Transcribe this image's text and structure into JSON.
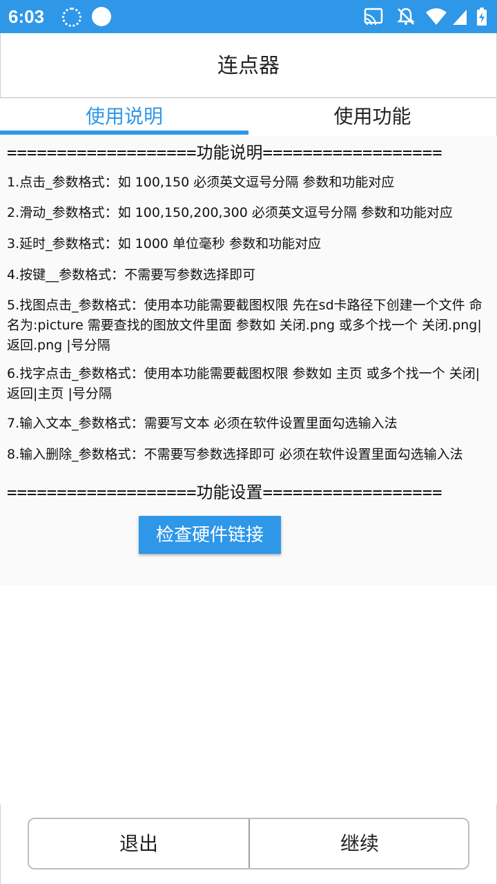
{
  "status_bar": {
    "time": "6:03",
    "icons": [
      "notification-dotted-circle-icon",
      "notification-circle-icon",
      "cast-icon",
      "notifications-off-icon",
      "wifi-icon",
      "cellular-signal-icon",
      "battery-charging-icon"
    ]
  },
  "dialog": {
    "title": "连点器",
    "tabs": [
      {
        "label": "使用说明",
        "selected": true
      },
      {
        "label": "使用功能",
        "selected": false
      }
    ]
  },
  "content": {
    "header_functions": {
      "rule_left": "===================",
      "title": "功能说明",
      "rule_right": "=================="
    },
    "items": [
      "1.点击_参数格式：如 100,150 必须英文逗号分隔 参数和功能对应",
      "2.滑动_参数格式：如 100,150,200,300 必须英文逗号分隔 参数和功能对应",
      "3.延时_参数格式：如 1000 单位毫秒 参数和功能对应",
      "4.按键__参数格式：不需要写参数选择即可",
      "5.找图点击_参数格式：使用本功能需要截图权限 先在sd卡路径下创建一个文件 命名为:picture 需要查找的图放文件里面 参数如 关闭.png 或多个找一个 关闭.png|返回.png |号分隔",
      "6.找字点击_参数格式：使用本功能需要截图权限 参数如 主页 或多个找一个 关闭|返回|主页 |号分隔",
      "7.输入文本_参数格式：需要写文本 必须在软件设置里面勾选输入法",
      "8.输入删除_参数格式：不需要写参数选择即可 必须在软件设置里面勾选输入法"
    ],
    "header_settings": {
      "rule_left": "===================",
      "title": "功能设置",
      "rule_right": "=================="
    },
    "check_button_label": "检查硬件链接"
  },
  "footer": {
    "exit_label": "退出",
    "continue_label": "继续"
  },
  "colors": {
    "accent": "#2e97e8"
  }
}
